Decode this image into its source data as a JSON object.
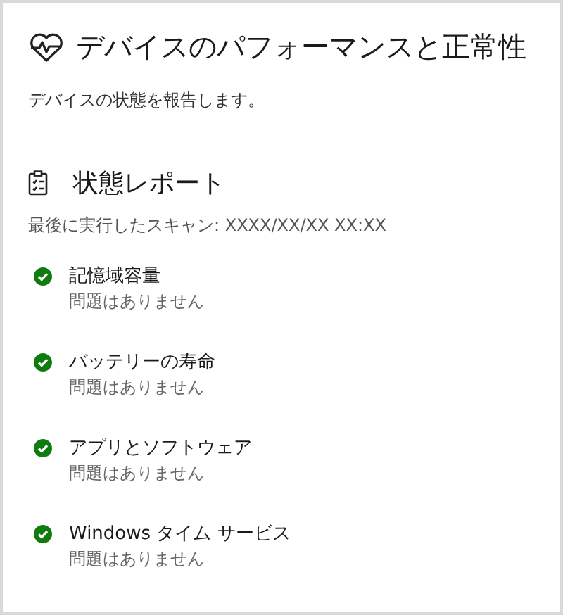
{
  "header": {
    "title": "デバイスのパフォーマンスと正常性",
    "description": "デバイスの状態を報告します。"
  },
  "report": {
    "title": "状態レポート",
    "last_scan": "最後に実行したスキャン: XXXX/XX/XX XX:XX",
    "items": [
      {
        "name": "記憶域容量",
        "passed": true,
        "detail": "問題はありません"
      },
      {
        "name": "バッテリーの寿命",
        "passed": true,
        "detail": "問題はありません"
      },
      {
        "name": "アプリとソフトウェア",
        "passed": true,
        "detail": "問題はありません"
      },
      {
        "name": "Windows タイム サービス",
        "passed": true,
        "detail": "問題はありません"
      }
    ]
  }
}
